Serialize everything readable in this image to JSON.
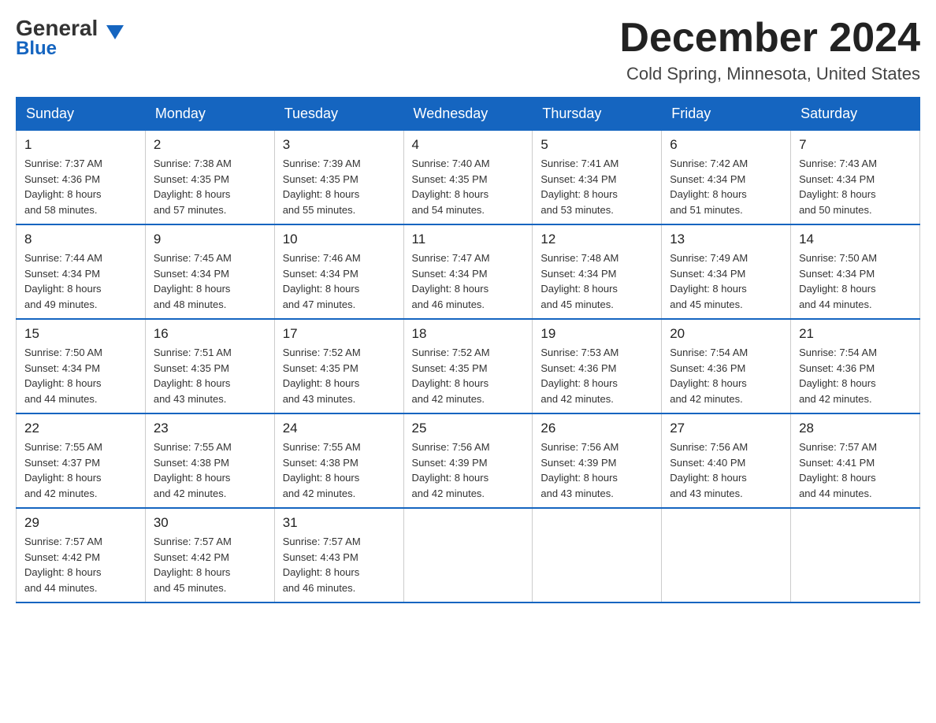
{
  "logo": {
    "general": "General",
    "arrow": "▼",
    "blue": "Blue"
  },
  "title": "December 2024",
  "location": "Cold Spring, Minnesota, United States",
  "days_of_week": [
    "Sunday",
    "Monday",
    "Tuesday",
    "Wednesday",
    "Thursday",
    "Friday",
    "Saturday"
  ],
  "weeks": [
    [
      {
        "day": "1",
        "sunrise": "7:37 AM",
        "sunset": "4:36 PM",
        "daylight": "8 hours and 58 minutes."
      },
      {
        "day": "2",
        "sunrise": "7:38 AM",
        "sunset": "4:35 PM",
        "daylight": "8 hours and 57 minutes."
      },
      {
        "day": "3",
        "sunrise": "7:39 AM",
        "sunset": "4:35 PM",
        "daylight": "8 hours and 55 minutes."
      },
      {
        "day": "4",
        "sunrise": "7:40 AM",
        "sunset": "4:35 PM",
        "daylight": "8 hours and 54 minutes."
      },
      {
        "day": "5",
        "sunrise": "7:41 AM",
        "sunset": "4:34 PM",
        "daylight": "8 hours and 53 minutes."
      },
      {
        "day": "6",
        "sunrise": "7:42 AM",
        "sunset": "4:34 PM",
        "daylight": "8 hours and 51 minutes."
      },
      {
        "day": "7",
        "sunrise": "7:43 AM",
        "sunset": "4:34 PM",
        "daylight": "8 hours and 50 minutes."
      }
    ],
    [
      {
        "day": "8",
        "sunrise": "7:44 AM",
        "sunset": "4:34 PM",
        "daylight": "8 hours and 49 minutes."
      },
      {
        "day": "9",
        "sunrise": "7:45 AM",
        "sunset": "4:34 PM",
        "daylight": "8 hours and 48 minutes."
      },
      {
        "day": "10",
        "sunrise": "7:46 AM",
        "sunset": "4:34 PM",
        "daylight": "8 hours and 47 minutes."
      },
      {
        "day": "11",
        "sunrise": "7:47 AM",
        "sunset": "4:34 PM",
        "daylight": "8 hours and 46 minutes."
      },
      {
        "day": "12",
        "sunrise": "7:48 AM",
        "sunset": "4:34 PM",
        "daylight": "8 hours and 45 minutes."
      },
      {
        "day": "13",
        "sunrise": "7:49 AM",
        "sunset": "4:34 PM",
        "daylight": "8 hours and 45 minutes."
      },
      {
        "day": "14",
        "sunrise": "7:50 AM",
        "sunset": "4:34 PM",
        "daylight": "8 hours and 44 minutes."
      }
    ],
    [
      {
        "day": "15",
        "sunrise": "7:50 AM",
        "sunset": "4:34 PM",
        "daylight": "8 hours and 44 minutes."
      },
      {
        "day": "16",
        "sunrise": "7:51 AM",
        "sunset": "4:35 PM",
        "daylight": "8 hours and 43 minutes."
      },
      {
        "day": "17",
        "sunrise": "7:52 AM",
        "sunset": "4:35 PM",
        "daylight": "8 hours and 43 minutes."
      },
      {
        "day": "18",
        "sunrise": "7:52 AM",
        "sunset": "4:35 PM",
        "daylight": "8 hours and 42 minutes."
      },
      {
        "day": "19",
        "sunrise": "7:53 AM",
        "sunset": "4:36 PM",
        "daylight": "8 hours and 42 minutes."
      },
      {
        "day": "20",
        "sunrise": "7:54 AM",
        "sunset": "4:36 PM",
        "daylight": "8 hours and 42 minutes."
      },
      {
        "day": "21",
        "sunrise": "7:54 AM",
        "sunset": "4:36 PM",
        "daylight": "8 hours and 42 minutes."
      }
    ],
    [
      {
        "day": "22",
        "sunrise": "7:55 AM",
        "sunset": "4:37 PM",
        "daylight": "8 hours and 42 minutes."
      },
      {
        "day": "23",
        "sunrise": "7:55 AM",
        "sunset": "4:38 PM",
        "daylight": "8 hours and 42 minutes."
      },
      {
        "day": "24",
        "sunrise": "7:55 AM",
        "sunset": "4:38 PM",
        "daylight": "8 hours and 42 minutes."
      },
      {
        "day": "25",
        "sunrise": "7:56 AM",
        "sunset": "4:39 PM",
        "daylight": "8 hours and 42 minutes."
      },
      {
        "day": "26",
        "sunrise": "7:56 AM",
        "sunset": "4:39 PM",
        "daylight": "8 hours and 43 minutes."
      },
      {
        "day": "27",
        "sunrise": "7:56 AM",
        "sunset": "4:40 PM",
        "daylight": "8 hours and 43 minutes."
      },
      {
        "day": "28",
        "sunrise": "7:57 AM",
        "sunset": "4:41 PM",
        "daylight": "8 hours and 44 minutes."
      }
    ],
    [
      {
        "day": "29",
        "sunrise": "7:57 AM",
        "sunset": "4:42 PM",
        "daylight": "8 hours and 44 minutes."
      },
      {
        "day": "30",
        "sunrise": "7:57 AM",
        "sunset": "4:42 PM",
        "daylight": "8 hours and 45 minutes."
      },
      {
        "day": "31",
        "sunrise": "7:57 AM",
        "sunset": "4:43 PM",
        "daylight": "8 hours and 46 minutes."
      },
      null,
      null,
      null,
      null
    ]
  ],
  "labels": {
    "sunrise": "Sunrise:",
    "sunset": "Sunset:",
    "daylight": "Daylight:"
  }
}
